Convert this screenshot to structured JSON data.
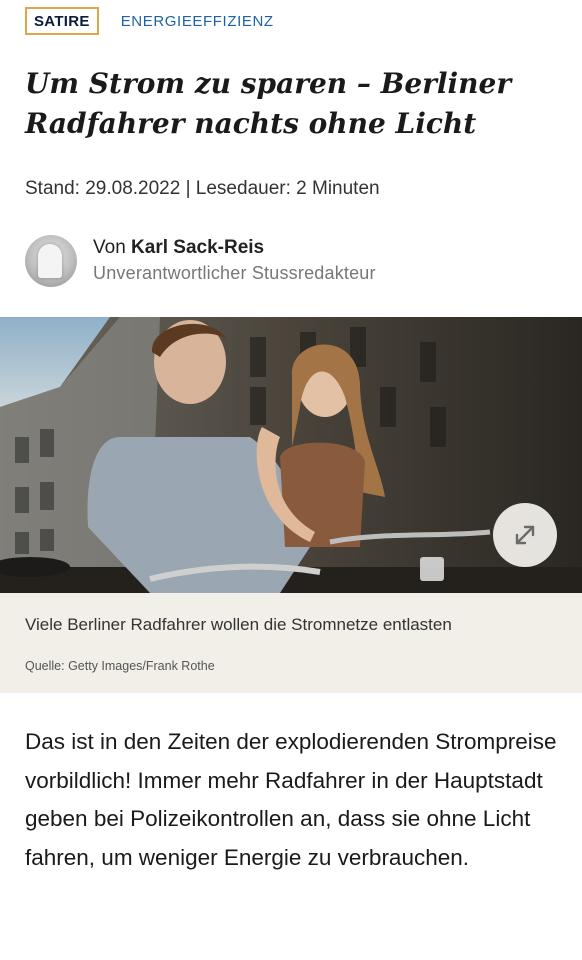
{
  "article": {
    "badge": "SATIRE",
    "kicker": "ENERGIEEFFIZIENZ",
    "headline": "Um Strom zu sparen – Berliner Radfahrer nachts ohne Licht",
    "meta": "Stand: 29.08.2022 | Lesedauer: 2 Minuten",
    "author": {
      "prefix": "Von",
      "name": "Karl Sack-Reis",
      "role": "Unverantwortlicher Stussredakteur"
    },
    "image": {
      "caption": "Viele Berliner Radfahrer wollen die Stromnetze entlasten",
      "source": "Quelle: Getty Images/Frank Rothe",
      "expand_icon": "expand-arrows-icon"
    },
    "body": "Das ist in den Zeiten der explodierenden Strompreise vorbildlich! Immer mehr Radfahrer in der Hauptstadt geben bei Polizeikontrollen an, dass sie ohne Licht fahren, um weniger Energie zu verbrauchen."
  },
  "colors": {
    "badge_border": "#e0a64a",
    "kicker": "#1d63a8",
    "caption_bg": "#f2efe9"
  }
}
